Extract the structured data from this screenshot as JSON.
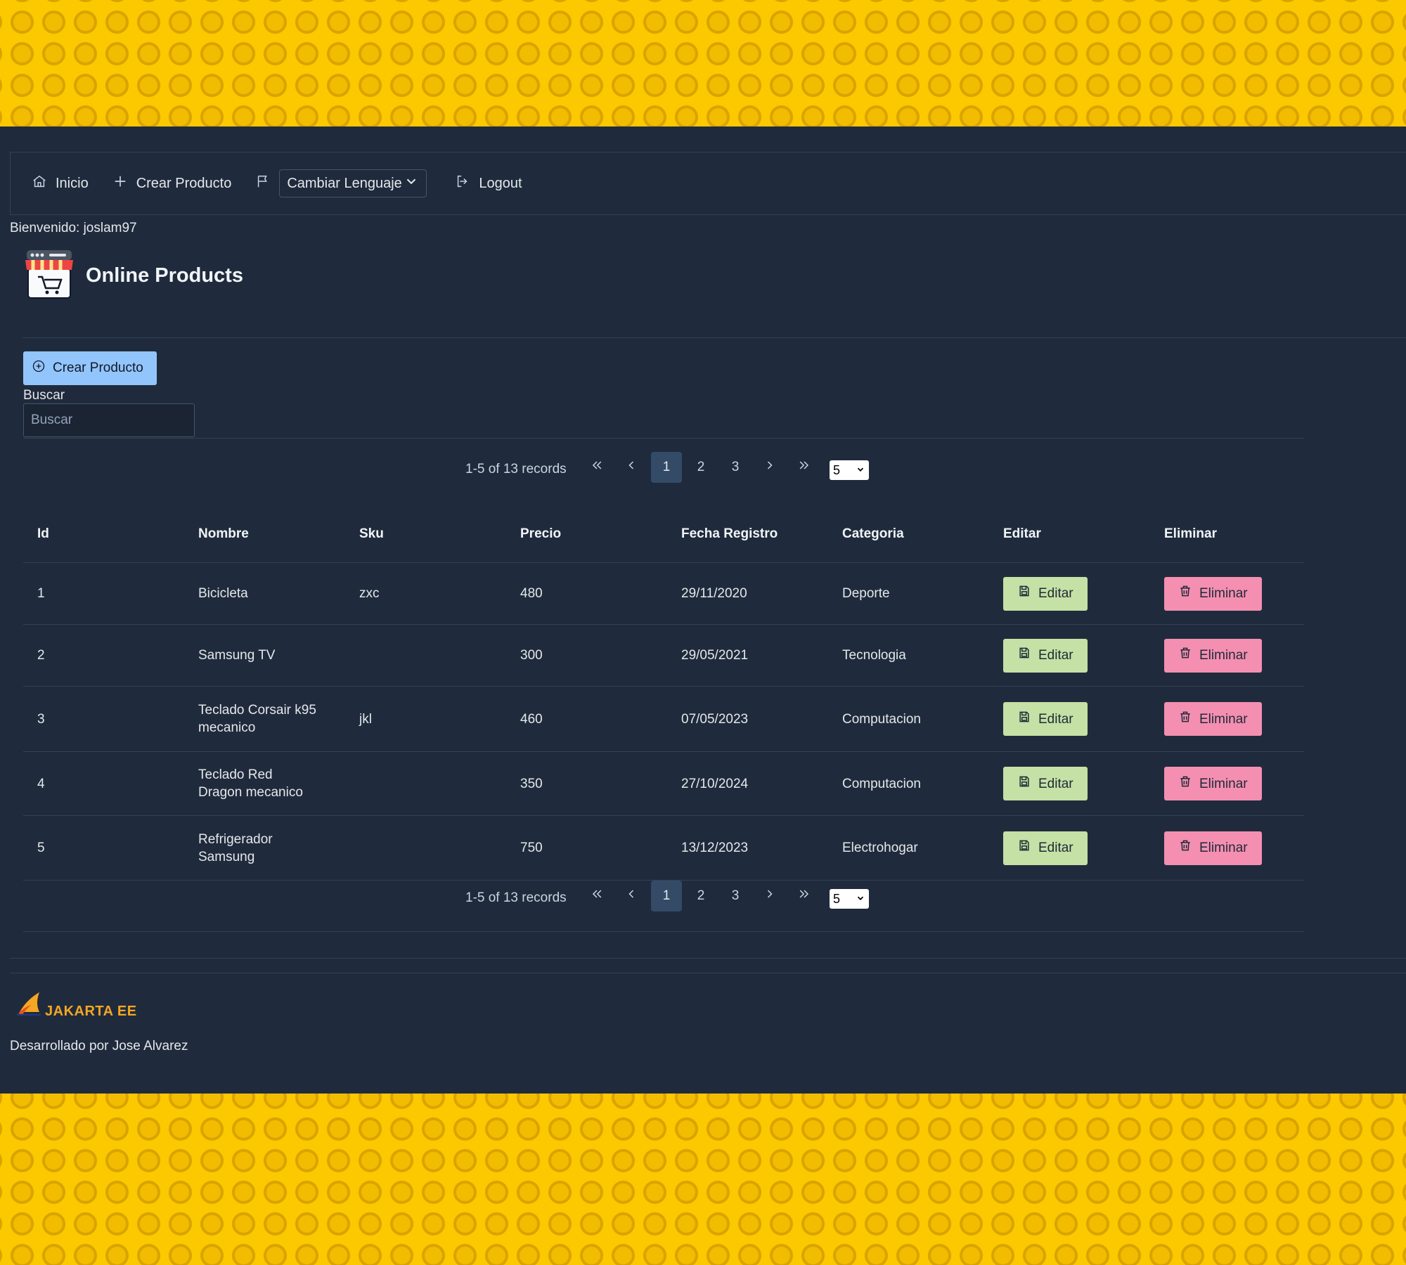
{
  "nav": {
    "home": "Inicio",
    "create": "Crear Producto",
    "language": "Cambiar Lenguaje",
    "logout": "Logout"
  },
  "welcome": "Bienvenido: joslam97",
  "brand": {
    "title": "Online Products"
  },
  "actions": {
    "create_button": "Crear Producto"
  },
  "search": {
    "label": "Buscar",
    "placeholder": "Buscar",
    "value": ""
  },
  "pagination": {
    "info": "1-5 of 13 records",
    "pages": [
      "1",
      "2",
      "3"
    ],
    "current": "1",
    "rows_per_page": "5"
  },
  "table": {
    "headers": [
      "Id",
      "Nombre",
      "Sku",
      "Precio",
      "Fecha Registro",
      "Categoria",
      "Editar",
      "Eliminar"
    ],
    "edit_label": "Editar",
    "delete_label": "Eliminar",
    "rows": [
      {
        "id": "1",
        "nombre": "Bicicleta",
        "sku": "zxc",
        "precio": "480",
        "fecha": "29/11/2020",
        "categoria": "Deporte"
      },
      {
        "id": "2",
        "nombre": "Samsung TV",
        "sku": "",
        "precio": "300",
        "fecha": "29/05/2021",
        "categoria": "Tecnologia"
      },
      {
        "id": "3",
        "nombre": "Teclado Corsair k95 mecanico",
        "sku": "jkl",
        "precio": "460",
        "fecha": "07/05/2023",
        "categoria": "Computacion"
      },
      {
        "id": "4",
        "nombre": "Teclado Red Dragon mecanico",
        "sku": "",
        "precio": "350",
        "fecha": "27/10/2024",
        "categoria": "Computacion"
      },
      {
        "id": "5",
        "nombre": "Refrigerador Samsung",
        "sku": "",
        "precio": "750",
        "fecha": "13/12/2023",
        "categoria": "Electrohogar"
      }
    ]
  },
  "footer": {
    "logo_text": "JAKARTA EE",
    "credits": "Desarrollado por Jose Alvarez"
  },
  "colors": {
    "background_pattern": "#fcc900",
    "panel": "#1f2b3c",
    "create_button": "#93c5fd",
    "edit_button": "#c5e1a5",
    "delete_button": "#f48fb1"
  }
}
